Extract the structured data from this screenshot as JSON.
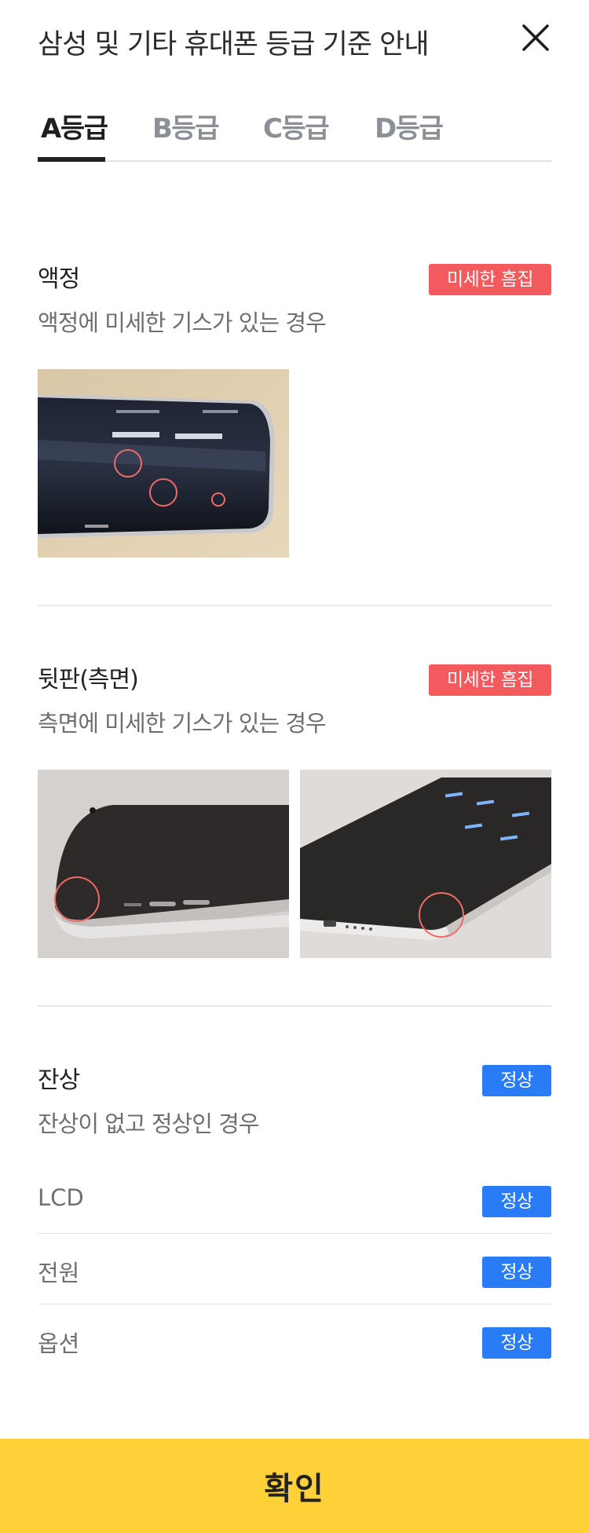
{
  "header": {
    "title": "삼성 및 기타 휴대폰 등급 기준 안내",
    "close_icon": "close-icon"
  },
  "tabs": [
    {
      "label": "A등급",
      "active": true
    },
    {
      "label": "B등급",
      "active": false
    },
    {
      "label": "C등급",
      "active": false
    },
    {
      "label": "D등급",
      "active": false
    }
  ],
  "sections": [
    {
      "title": "액정",
      "badge": "미세한 흠집",
      "description": "액정에 미세한 기스가 있는 경우"
    },
    {
      "title": "뒷판(측면)",
      "badge": "미세한 흠집",
      "description": "측면에 미세한 기스가 있는 경우"
    },
    {
      "title": "잔상",
      "badge": "정상",
      "description": "잔상이 없고 정상인 경우"
    }
  ],
  "status_rows": [
    {
      "label": "LCD",
      "badge": "정상"
    },
    {
      "label": "전원",
      "badge": "정상"
    },
    {
      "label": "옵션",
      "badge": "정상"
    }
  ],
  "footer": {
    "confirm_label": "확인"
  },
  "colors": {
    "accent_yellow": "#ffd138",
    "badge_red": "#f25a5d",
    "badge_blue": "#2a7cf6"
  }
}
